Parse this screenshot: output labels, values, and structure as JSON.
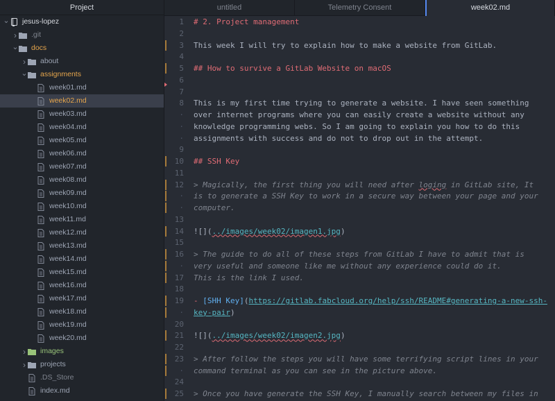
{
  "sidebar": {
    "title": "Project",
    "root": "jesus-lopez",
    "items": [
      {
        "label": "jesus-lopez",
        "depth": 0,
        "arrow": "open",
        "icon": "repo",
        "color": "white",
        "row": 0
      },
      {
        "label": ".git",
        "depth": 1,
        "arrow": "closed",
        "icon": "folder",
        "color": "dim",
        "row": 1
      },
      {
        "label": "docs",
        "depth": 1,
        "arrow": "open",
        "icon": "folder",
        "color": "orange",
        "row": 2
      },
      {
        "label": "about",
        "depth": 2,
        "arrow": "closed",
        "icon": "folder",
        "color": "normal",
        "row": 3
      },
      {
        "label": "assignments",
        "depth": 2,
        "arrow": "open",
        "icon": "folder",
        "color": "orange",
        "row": 4
      },
      {
        "label": "week01.md",
        "depth": 3,
        "icon": "file",
        "color": "normal",
        "row": 5
      },
      {
        "label": "week02.md",
        "depth": 3,
        "icon": "file",
        "color": "orange",
        "row": 6,
        "selected": true
      },
      {
        "label": "week03.md",
        "depth": 3,
        "icon": "file",
        "color": "normal",
        "row": 7
      },
      {
        "label": "week04.md",
        "depth": 3,
        "icon": "file",
        "color": "normal",
        "row": 8
      },
      {
        "label": "week05.md",
        "depth": 3,
        "icon": "file",
        "color": "normal",
        "row": 9
      },
      {
        "label": "week06.md",
        "depth": 3,
        "icon": "file",
        "color": "normal",
        "row": 10
      },
      {
        "label": "week07.md",
        "depth": 3,
        "icon": "file",
        "color": "normal",
        "row": 11
      },
      {
        "label": "week08.md",
        "depth": 3,
        "icon": "file",
        "color": "normal",
        "row": 12
      },
      {
        "label": "week09.md",
        "depth": 3,
        "icon": "file",
        "color": "normal",
        "row": 13
      },
      {
        "label": "week10.md",
        "depth": 3,
        "icon": "file",
        "color": "normal",
        "row": 14
      },
      {
        "label": "week11.md",
        "depth": 3,
        "icon": "file",
        "color": "normal",
        "row": 15
      },
      {
        "label": "week12.md",
        "depth": 3,
        "icon": "file",
        "color": "normal",
        "row": 16
      },
      {
        "label": "week13.md",
        "depth": 3,
        "icon": "file",
        "color": "normal",
        "row": 17
      },
      {
        "label": "week14.md",
        "depth": 3,
        "icon": "file",
        "color": "normal",
        "row": 18
      },
      {
        "label": "week15.md",
        "depth": 3,
        "icon": "file",
        "color": "normal",
        "row": 19
      },
      {
        "label": "week16.md",
        "depth": 3,
        "icon": "file",
        "color": "normal",
        "row": 20
      },
      {
        "label": "week17.md",
        "depth": 3,
        "icon": "file",
        "color": "normal",
        "row": 21
      },
      {
        "label": "week18.md",
        "depth": 3,
        "icon": "file",
        "color": "normal",
        "row": 22
      },
      {
        "label": "week19.md",
        "depth": 3,
        "icon": "file",
        "color": "normal",
        "row": 23
      },
      {
        "label": "week20.md",
        "depth": 3,
        "icon": "file",
        "color": "normal",
        "row": 24
      },
      {
        "label": "images",
        "depth": 2,
        "arrow": "closed",
        "icon": "folder-green",
        "color": "green",
        "row": 25
      },
      {
        "label": "projects",
        "depth": 2,
        "arrow": "closed",
        "icon": "folder",
        "color": "normal",
        "row": 26
      },
      {
        "label": ".DS_Store",
        "depth": 2,
        "icon": "file",
        "color": "dim",
        "row": 27
      },
      {
        "label": "index.md",
        "depth": 2,
        "icon": "file",
        "color": "normal",
        "row": 28
      }
    ]
  },
  "tabs": [
    {
      "label": "untitled",
      "active": false
    },
    {
      "label": "Telemetry Consent",
      "active": false
    },
    {
      "label": "week02.md",
      "active": true
    }
  ],
  "editor": {
    "lines": [
      {
        "n": "1",
        "mark": false,
        "segs": [
          {
            "t": "# 2. Project management",
            "c": "heading"
          }
        ]
      },
      {
        "n": "2",
        "segs": []
      },
      {
        "n": "3",
        "mark": true,
        "segs": [
          {
            "t": "This week I will try to explain how to make a website from GitLab.",
            "c": "normal"
          }
        ]
      },
      {
        "n": "4",
        "segs": []
      },
      {
        "n": "5",
        "mark": true,
        "segs": [
          {
            "t": "## How to survive a GitLab Website on macOS",
            "c": "heading"
          }
        ]
      },
      {
        "n": "6",
        "segs": []
      },
      {
        "n": "7",
        "segs": []
      },
      {
        "n": "8",
        "segs": [
          {
            "t": "This is my first time trying to generate a website. I have seen something",
            "c": "normal"
          }
        ]
      },
      {
        "n": "·",
        "cont": true,
        "segs": [
          {
            "t": "over internet programs where you can easily create a website without any",
            "c": "normal"
          }
        ]
      },
      {
        "n": "·",
        "cont": true,
        "segs": [
          {
            "t": "knowledge programming webs. So I am going to explain you how to do this",
            "c": "normal"
          }
        ]
      },
      {
        "n": "·",
        "cont": true,
        "segs": [
          {
            "t": "assignments with success and do not to drop out in the attempt.",
            "c": "normal"
          }
        ]
      },
      {
        "n": "9",
        "segs": []
      },
      {
        "n": "10",
        "mark": true,
        "segs": [
          {
            "t": "## SSH Key",
            "c": "heading"
          }
        ]
      },
      {
        "n": "11",
        "segs": []
      },
      {
        "n": "12",
        "mark": true,
        "segs": [
          {
            "t": "> Magically, the first thing you will need after ",
            "c": "quote"
          },
          {
            "t": "loging",
            "c": "quote squig"
          },
          {
            "t": " in GitLab site, It",
            "c": "quote"
          }
        ]
      },
      {
        "n": "·",
        "cont": true,
        "mark": true,
        "segs": [
          {
            "t": "is to generate a SSH Key to work in a secure way between your page and your",
            "c": "quote"
          }
        ]
      },
      {
        "n": "·",
        "cont": true,
        "mark": true,
        "segs": [
          {
            "t": "computer.",
            "c": "quote"
          }
        ]
      },
      {
        "n": "13",
        "segs": []
      },
      {
        "n": "14",
        "mark": true,
        "segs": [
          {
            "t": "![](",
            "c": "normal"
          },
          {
            "t": "../images/week02/imagen1.jpg",
            "c": "link squig"
          },
          {
            "t": ")",
            "c": "normal"
          }
        ]
      },
      {
        "n": "15",
        "segs": []
      },
      {
        "n": "16",
        "mark": true,
        "segs": [
          {
            "t": "> The guide to do all of these steps from GitLab I have to admit that is",
            "c": "quote"
          }
        ]
      },
      {
        "n": "·",
        "cont": true,
        "mark": true,
        "segs": [
          {
            "t": "very useful and someone like me without any experience could do it.",
            "c": "quote"
          }
        ]
      },
      {
        "n": "17",
        "mark": true,
        "segs": [
          {
            "t": "This is the link I used.",
            "c": "quote"
          }
        ]
      },
      {
        "n": "18",
        "segs": []
      },
      {
        "n": "19",
        "mark": true,
        "segs": [
          {
            "t": "- ",
            "c": "dash"
          },
          {
            "t": "[SHH Key]",
            "c": "linktext"
          },
          {
            "t": "(",
            "c": "normal"
          },
          {
            "t": "https://gitlab.fabcloud.org/help/ssh/README#generating-a-new-ssh-",
            "c": "link"
          }
        ]
      },
      {
        "n": "·",
        "cont": true,
        "mark": true,
        "segs": [
          {
            "t": "key-pair",
            "c": "link"
          },
          {
            "t": ")",
            "c": "normal"
          }
        ]
      },
      {
        "n": "20",
        "segs": []
      },
      {
        "n": "21",
        "mark": true,
        "segs": [
          {
            "t": "![](",
            "c": "normal"
          },
          {
            "t": "../images/week02/imagen2.jpg",
            "c": "link squig"
          },
          {
            "t": ")",
            "c": "normal"
          }
        ]
      },
      {
        "n": "22",
        "segs": []
      },
      {
        "n": "23",
        "mark": true,
        "segs": [
          {
            "t": "> After follow the steps you will have some terrifying script lines in your",
            "c": "quote"
          }
        ]
      },
      {
        "n": "·",
        "cont": true,
        "mark": true,
        "segs": [
          {
            "t": "command terminal as you can see in the picture above.",
            "c": "quote"
          }
        ]
      },
      {
        "n": "24",
        "segs": []
      },
      {
        "n": "25",
        "mark": true,
        "segs": [
          {
            "t": "> Once you have generate the SSH Key, I manually search between my files in",
            "c": "quote"
          }
        ]
      }
    ]
  }
}
